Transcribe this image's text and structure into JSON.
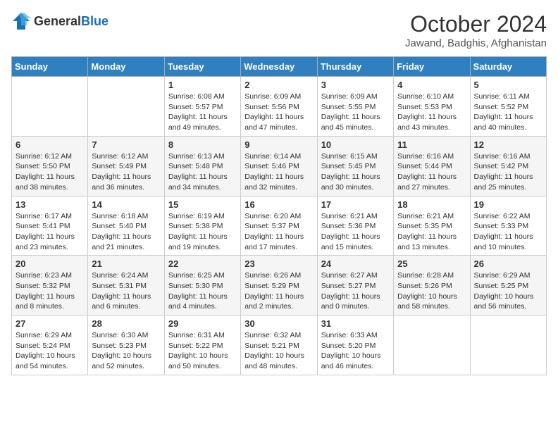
{
  "logo": {
    "general": "General",
    "blue": "Blue"
  },
  "header": {
    "month_year": "October 2024",
    "location": "Jawand, Badghis, Afghanistan"
  },
  "weekdays": [
    "Sunday",
    "Monday",
    "Tuesday",
    "Wednesday",
    "Thursday",
    "Friday",
    "Saturday"
  ],
  "weeks": [
    [
      {
        "day": "",
        "sunrise": "",
        "sunset": "",
        "daylight": ""
      },
      {
        "day": "",
        "sunrise": "",
        "sunset": "",
        "daylight": ""
      },
      {
        "day": "1",
        "sunrise": "Sunrise: 6:08 AM",
        "sunset": "Sunset: 5:57 PM",
        "daylight": "Daylight: 11 hours and 49 minutes."
      },
      {
        "day": "2",
        "sunrise": "Sunrise: 6:09 AM",
        "sunset": "Sunset: 5:56 PM",
        "daylight": "Daylight: 11 hours and 47 minutes."
      },
      {
        "day": "3",
        "sunrise": "Sunrise: 6:09 AM",
        "sunset": "Sunset: 5:55 PM",
        "daylight": "Daylight: 11 hours and 45 minutes."
      },
      {
        "day": "4",
        "sunrise": "Sunrise: 6:10 AM",
        "sunset": "Sunset: 5:53 PM",
        "daylight": "Daylight: 11 hours and 43 minutes."
      },
      {
        "day": "5",
        "sunrise": "Sunrise: 6:11 AM",
        "sunset": "Sunset: 5:52 PM",
        "daylight": "Daylight: 11 hours and 40 minutes."
      }
    ],
    [
      {
        "day": "6",
        "sunrise": "Sunrise: 6:12 AM",
        "sunset": "Sunset: 5:50 PM",
        "daylight": "Daylight: 11 hours and 38 minutes."
      },
      {
        "day": "7",
        "sunrise": "Sunrise: 6:12 AM",
        "sunset": "Sunset: 5:49 PM",
        "daylight": "Daylight: 11 hours and 36 minutes."
      },
      {
        "day": "8",
        "sunrise": "Sunrise: 6:13 AM",
        "sunset": "Sunset: 5:48 PM",
        "daylight": "Daylight: 11 hours and 34 minutes."
      },
      {
        "day": "9",
        "sunrise": "Sunrise: 6:14 AM",
        "sunset": "Sunset: 5:46 PM",
        "daylight": "Daylight: 11 hours and 32 minutes."
      },
      {
        "day": "10",
        "sunrise": "Sunrise: 6:15 AM",
        "sunset": "Sunset: 5:45 PM",
        "daylight": "Daylight: 11 hours and 30 minutes."
      },
      {
        "day": "11",
        "sunrise": "Sunrise: 6:16 AM",
        "sunset": "Sunset: 5:44 PM",
        "daylight": "Daylight: 11 hours and 27 minutes."
      },
      {
        "day": "12",
        "sunrise": "Sunrise: 6:16 AM",
        "sunset": "Sunset: 5:42 PM",
        "daylight": "Daylight: 11 hours and 25 minutes."
      }
    ],
    [
      {
        "day": "13",
        "sunrise": "Sunrise: 6:17 AM",
        "sunset": "Sunset: 5:41 PM",
        "daylight": "Daylight: 11 hours and 23 minutes."
      },
      {
        "day": "14",
        "sunrise": "Sunrise: 6:18 AM",
        "sunset": "Sunset: 5:40 PM",
        "daylight": "Daylight: 11 hours and 21 minutes."
      },
      {
        "day": "15",
        "sunrise": "Sunrise: 6:19 AM",
        "sunset": "Sunset: 5:38 PM",
        "daylight": "Daylight: 11 hours and 19 minutes."
      },
      {
        "day": "16",
        "sunrise": "Sunrise: 6:20 AM",
        "sunset": "Sunset: 5:37 PM",
        "daylight": "Daylight: 11 hours and 17 minutes."
      },
      {
        "day": "17",
        "sunrise": "Sunrise: 6:21 AM",
        "sunset": "Sunset: 5:36 PM",
        "daylight": "Daylight: 11 hours and 15 minutes."
      },
      {
        "day": "18",
        "sunrise": "Sunrise: 6:21 AM",
        "sunset": "Sunset: 5:35 PM",
        "daylight": "Daylight: 11 hours and 13 minutes."
      },
      {
        "day": "19",
        "sunrise": "Sunrise: 6:22 AM",
        "sunset": "Sunset: 5:33 PM",
        "daylight": "Daylight: 11 hours and 10 minutes."
      }
    ],
    [
      {
        "day": "20",
        "sunrise": "Sunrise: 6:23 AM",
        "sunset": "Sunset: 5:32 PM",
        "daylight": "Daylight: 11 hours and 8 minutes."
      },
      {
        "day": "21",
        "sunrise": "Sunrise: 6:24 AM",
        "sunset": "Sunset: 5:31 PM",
        "daylight": "Daylight: 11 hours and 6 minutes."
      },
      {
        "day": "22",
        "sunrise": "Sunrise: 6:25 AM",
        "sunset": "Sunset: 5:30 PM",
        "daylight": "Daylight: 11 hours and 4 minutes."
      },
      {
        "day": "23",
        "sunrise": "Sunrise: 6:26 AM",
        "sunset": "Sunset: 5:29 PM",
        "daylight": "Daylight: 11 hours and 2 minutes."
      },
      {
        "day": "24",
        "sunrise": "Sunrise: 6:27 AM",
        "sunset": "Sunset: 5:27 PM",
        "daylight": "Daylight: 11 hours and 0 minutes."
      },
      {
        "day": "25",
        "sunrise": "Sunrise: 6:28 AM",
        "sunset": "Sunset: 5:26 PM",
        "daylight": "Daylight: 10 hours and 58 minutes."
      },
      {
        "day": "26",
        "sunrise": "Sunrise: 6:29 AM",
        "sunset": "Sunset: 5:25 PM",
        "daylight": "Daylight: 10 hours and 56 minutes."
      }
    ],
    [
      {
        "day": "27",
        "sunrise": "Sunrise: 6:29 AM",
        "sunset": "Sunset: 5:24 PM",
        "daylight": "Daylight: 10 hours and 54 minutes."
      },
      {
        "day": "28",
        "sunrise": "Sunrise: 6:30 AM",
        "sunset": "Sunset: 5:23 PM",
        "daylight": "Daylight: 10 hours and 52 minutes."
      },
      {
        "day": "29",
        "sunrise": "Sunrise: 6:31 AM",
        "sunset": "Sunset: 5:22 PM",
        "daylight": "Daylight: 10 hours and 50 minutes."
      },
      {
        "day": "30",
        "sunrise": "Sunrise: 6:32 AM",
        "sunset": "Sunset: 5:21 PM",
        "daylight": "Daylight: 10 hours and 48 minutes."
      },
      {
        "day": "31",
        "sunrise": "Sunrise: 6:33 AM",
        "sunset": "Sunset: 5:20 PM",
        "daylight": "Daylight: 10 hours and 46 minutes."
      },
      {
        "day": "",
        "sunrise": "",
        "sunset": "",
        "daylight": ""
      },
      {
        "day": "",
        "sunrise": "",
        "sunset": "",
        "daylight": ""
      }
    ]
  ]
}
